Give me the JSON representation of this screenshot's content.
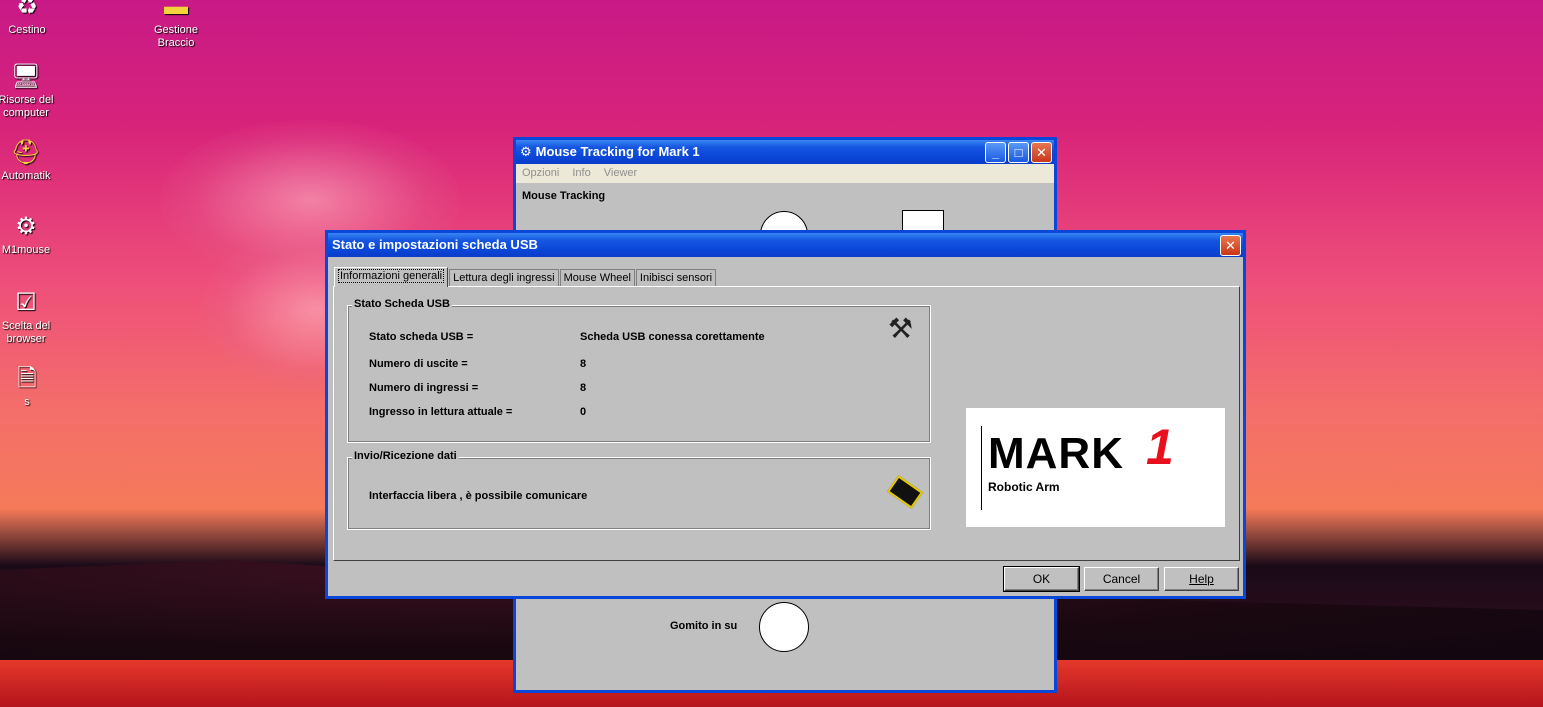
{
  "desktop": {
    "icons": [
      {
        "label": "Cestino",
        "icon": "recycle-bin-icon"
      },
      {
        "label": "Gestione Braccio",
        "icon": "folder-icon"
      },
      {
        "label": "Risorse del computer",
        "icon": "computer-icon"
      },
      {
        "label": "Automatik",
        "icon": "hardhat-icon"
      },
      {
        "label": "M1mouse",
        "icon": "gear-icon"
      },
      {
        "label": "Scelta del browser",
        "icon": "checklist-icon"
      },
      {
        "label": "s",
        "icon": "text-file-icon"
      }
    ]
  },
  "bg_window": {
    "title": "Mouse Tracking for Mark 1",
    "menu": [
      "Opzioni",
      "Info",
      "Viewer"
    ],
    "group_title": "Mouse Tracking",
    "bottom_label": "Gomito in su",
    "buttons": {
      "minimize": "_",
      "maximize": "□",
      "close": "✕"
    }
  },
  "dialog": {
    "title": "Stato e impostazioni scheda USB",
    "close_glyph": "✕",
    "tabs": [
      "Informazioni generali",
      "Lettura degli ingressi",
      "Mouse Wheel",
      "Inibisci sensori"
    ],
    "status_group": {
      "title": "Stato Scheda USB",
      "rows": [
        {
          "label": "Stato scheda USB =",
          "value": "Scheda USB conessa corettamente"
        },
        {
          "label": "Numero di uscite  =",
          "value": "8"
        },
        {
          "label": "Numero di ingressi =",
          "value": "8"
        },
        {
          "label": "Ingresso in lettura attuale =",
          "value": "0"
        }
      ]
    },
    "comm_group": {
      "title": "Invio/Ricezione dati",
      "text": "Interfaccia libera , è possibile comunicare"
    },
    "logo": {
      "brand": "MARK",
      "number": "1",
      "tagline": "Robotic Arm"
    },
    "buttons": {
      "ok": "OK",
      "cancel": "Cancel",
      "help": "Help"
    }
  },
  "colors": {
    "titlebar": "#0a46d8",
    "dialog_bg": "#c0c0c0",
    "logo_red": "#e8101c"
  }
}
